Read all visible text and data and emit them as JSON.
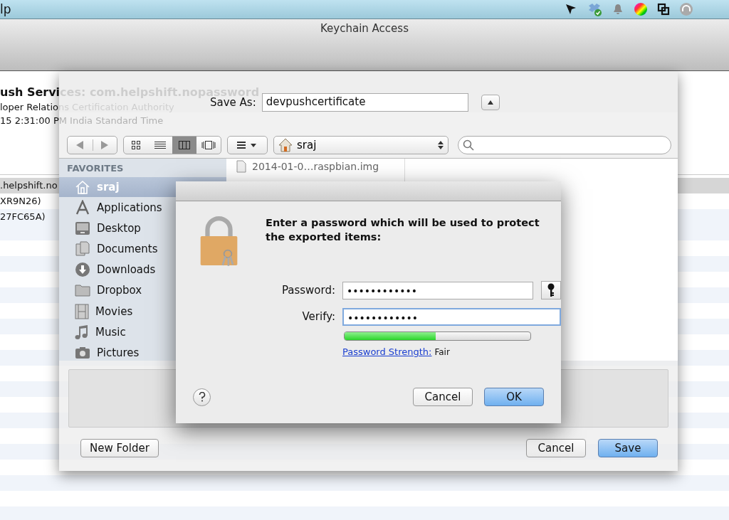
{
  "menu_bar": {
    "menu": "lp"
  },
  "window": {
    "title": "Keychain Access"
  },
  "certificate": {
    "name": "ush Services: com.helpshift.nopassword",
    "issuer": "loper Relations Certification Authority",
    "expires": "15 2:31:00 PM India Standard Time"
  },
  "list_rows": [
    {
      "text": ".helpshift.no",
      "selected": true
    },
    {
      "text": "XR9N26)",
      "selected": false
    },
    {
      "text": "27FC65A)",
      "selected": false
    }
  ],
  "save_sheet": {
    "save_as_label": "Save As:",
    "filename": "devpushcertificate",
    "location": "sraj",
    "view_modes": [
      {
        "kind": "icons",
        "selected": false
      },
      {
        "kind": "list",
        "selected": false
      },
      {
        "kind": "columns",
        "selected": true
      },
      {
        "kind": "coverflow",
        "selected": false
      }
    ],
    "sidebar": {
      "heading": "FAVORITES",
      "items": [
        {
          "label": "sraj",
          "kind": "home",
          "selected": true
        },
        {
          "label": "Applications",
          "kind": "apps",
          "selected": false
        },
        {
          "label": "Desktop",
          "kind": "desktop",
          "selected": false
        },
        {
          "label": "Documents",
          "kind": "documents",
          "selected": false
        },
        {
          "label": "Downloads",
          "kind": "downloads",
          "selected": false
        },
        {
          "label": "Dropbox",
          "kind": "folder",
          "selected": false
        },
        {
          "label": "Movies",
          "kind": "movies",
          "selected": false
        },
        {
          "label": "Music",
          "kind": "music",
          "selected": false
        },
        {
          "label": "Pictures",
          "kind": "pictures",
          "selected": false
        }
      ]
    },
    "files": [
      "2014-01-0…raspbian.img"
    ],
    "buttons": [
      {
        "label": "New Folder",
        "default": false
      },
      {
        "label": "Cancel",
        "default": false
      },
      {
        "label": "Save",
        "default": true
      }
    ]
  },
  "password_dialog": {
    "message": "Enter a password which will be used to protect the exported items:",
    "fields": [
      {
        "label": "Password:",
        "value": "••••••••••••",
        "focused": false
      },
      {
        "label": "Verify:",
        "value": "••••••••••••",
        "focused": true
      }
    ],
    "strength": {
      "level": 0.49,
      "link": "Password Strength:",
      "rating": "Fair"
    },
    "buttons": [
      {
        "label": "Cancel",
        "default": false
      },
      {
        "label": "OK",
        "default": true
      }
    ]
  }
}
